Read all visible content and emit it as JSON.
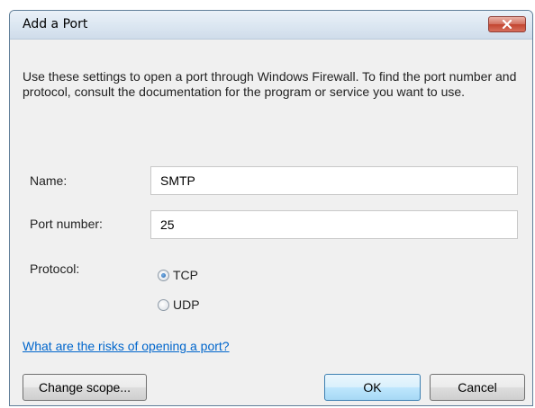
{
  "window": {
    "title": "Add a Port"
  },
  "description": "Use these settings to open a port through Windows Firewall. To find the port number and protocol, consult the documentation for the program or service you want to use.",
  "fields": {
    "name_label": "Name:",
    "name_value": "SMTP",
    "port_label": "Port number:",
    "port_value": "25",
    "protocol_label": "Protocol:"
  },
  "protocol": {
    "options": [
      "TCP",
      "UDP"
    ],
    "selected": "TCP"
  },
  "link_text": "What are the risks of opening a port?",
  "buttons": {
    "change_scope": "Change scope...",
    "ok": "OK",
    "cancel": "Cancel"
  }
}
